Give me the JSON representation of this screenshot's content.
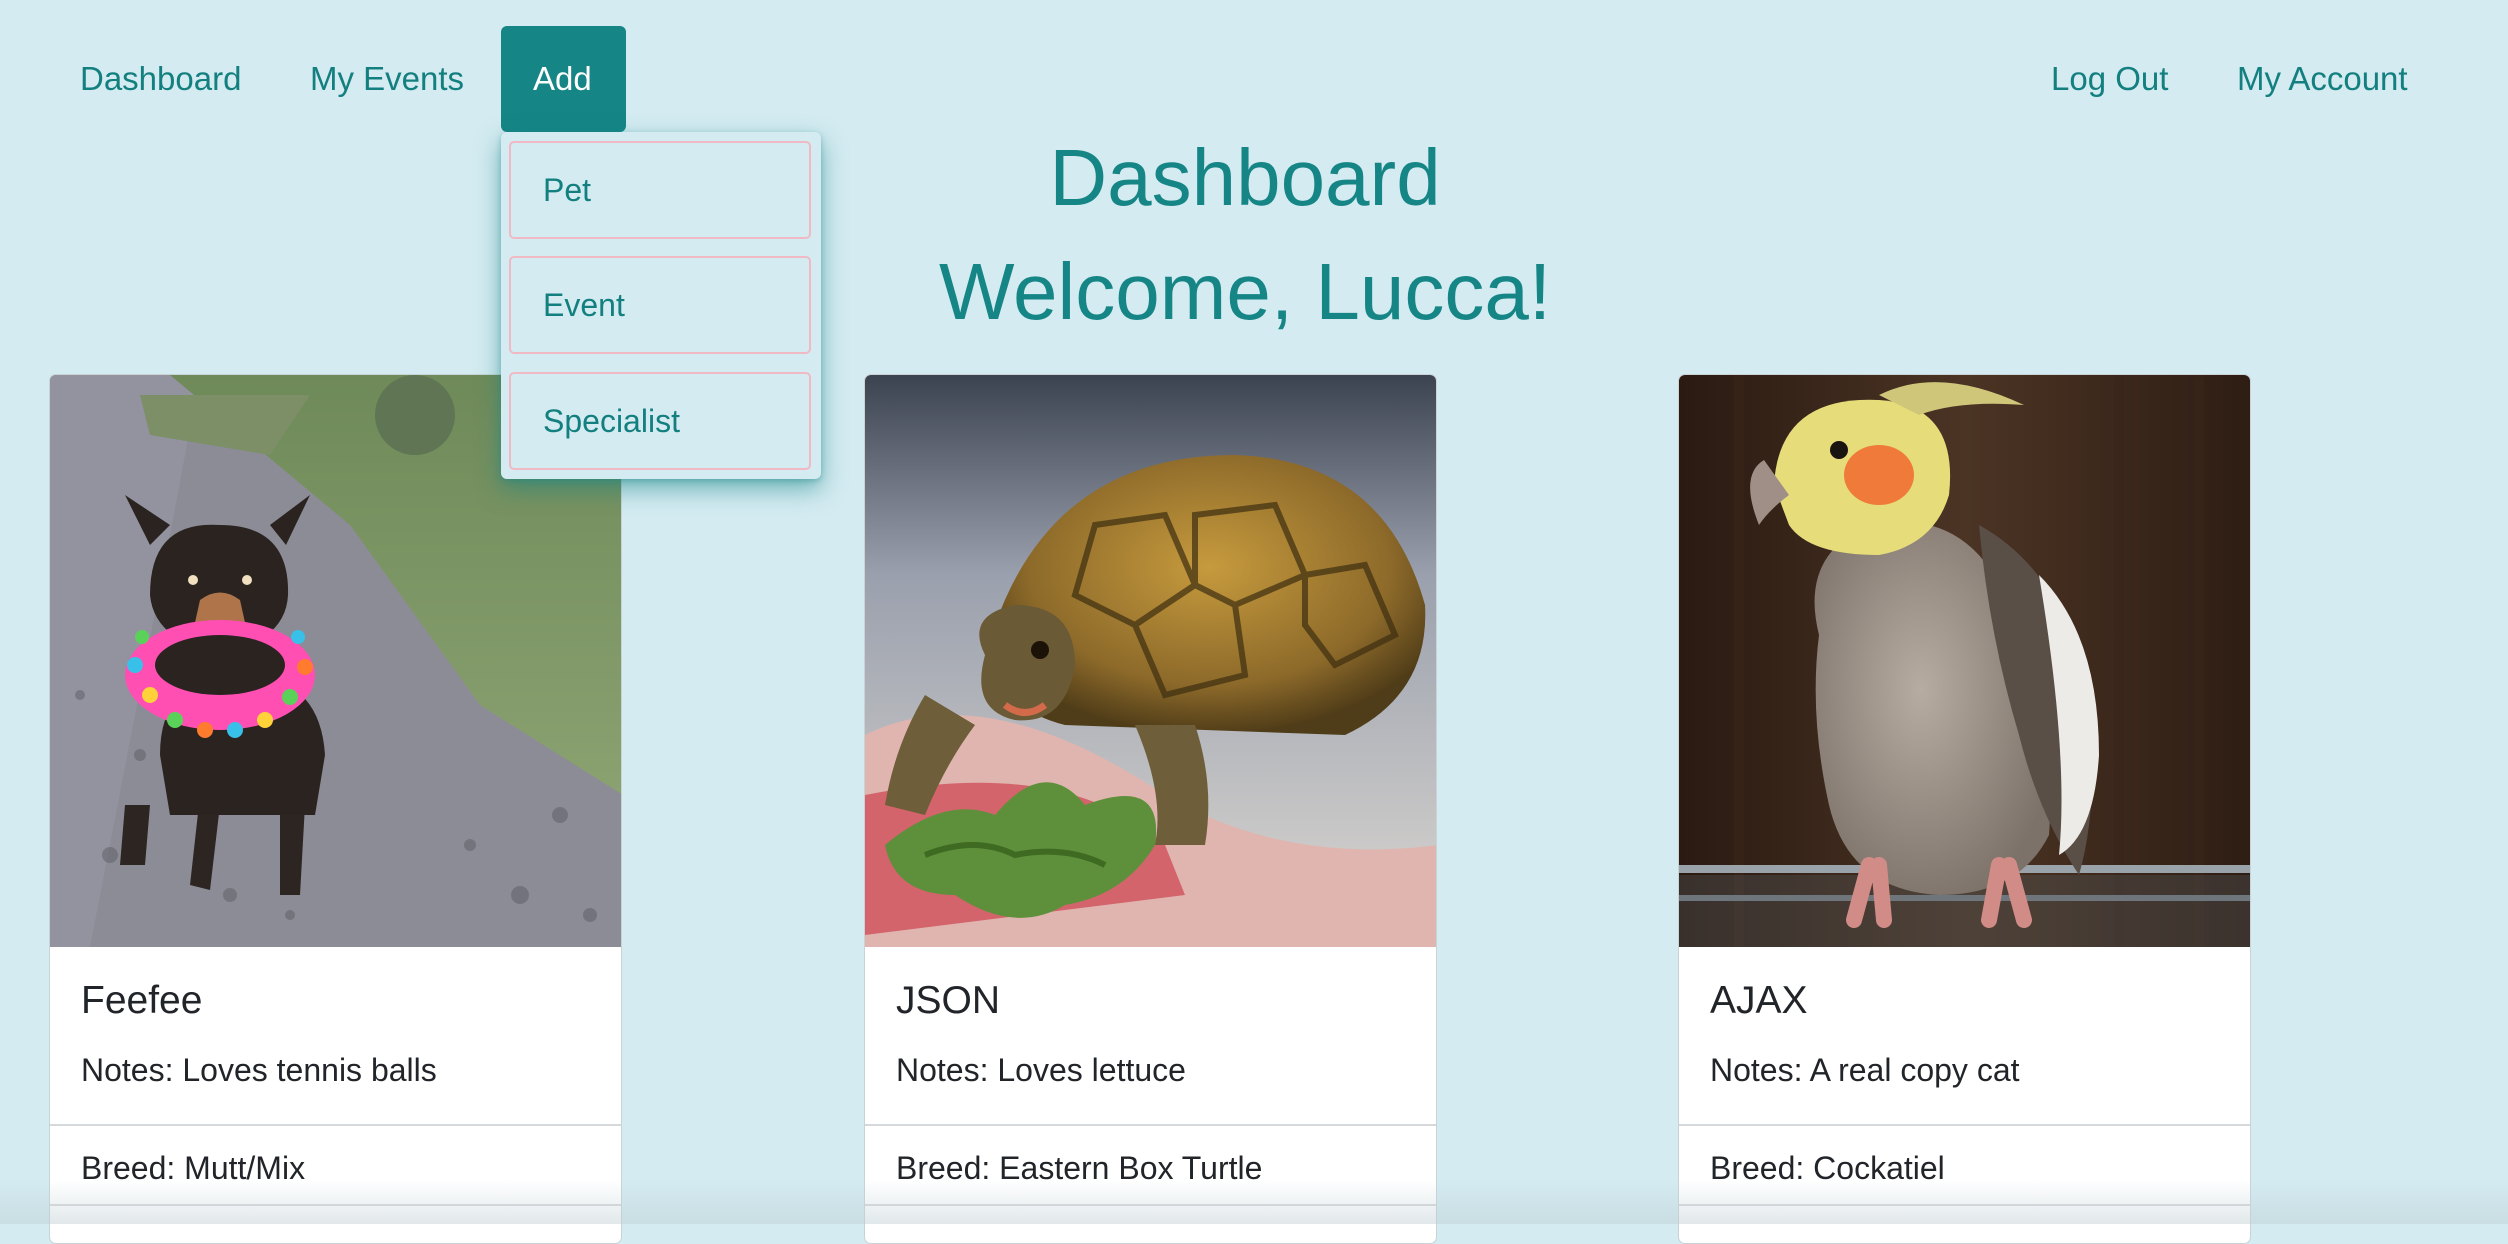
{
  "nav": {
    "dashboard": "Dashboard",
    "my_events": "My Events",
    "add": "Add",
    "log_out": "Log Out",
    "my_account": "My Account"
  },
  "add_menu": {
    "items": [
      "Pet",
      "Event",
      "Specialist"
    ]
  },
  "page": {
    "title": "Dashboard",
    "welcome": "Welcome, Lucca!"
  },
  "pets": [
    {
      "name": "Feefee",
      "notes": "Notes: Loves tennis balls",
      "breed": "Breed: Mutt/Mix",
      "photo": "dog-photo"
    },
    {
      "name": "JSON",
      "notes": "Notes: Loves lettuce",
      "breed": "Breed: Eastern Box Turtle",
      "photo": "tortoise-photo"
    },
    {
      "name": "AJAX",
      "notes": "Notes: A real copy cat",
      "breed": "Breed: Cockatiel",
      "photo": "cockatiel-photo"
    }
  ],
  "colors": {
    "background": "#d3ebf1",
    "accent": "#168585",
    "link": "#137f7f",
    "dropdown_border": "#f1b9c4"
  }
}
